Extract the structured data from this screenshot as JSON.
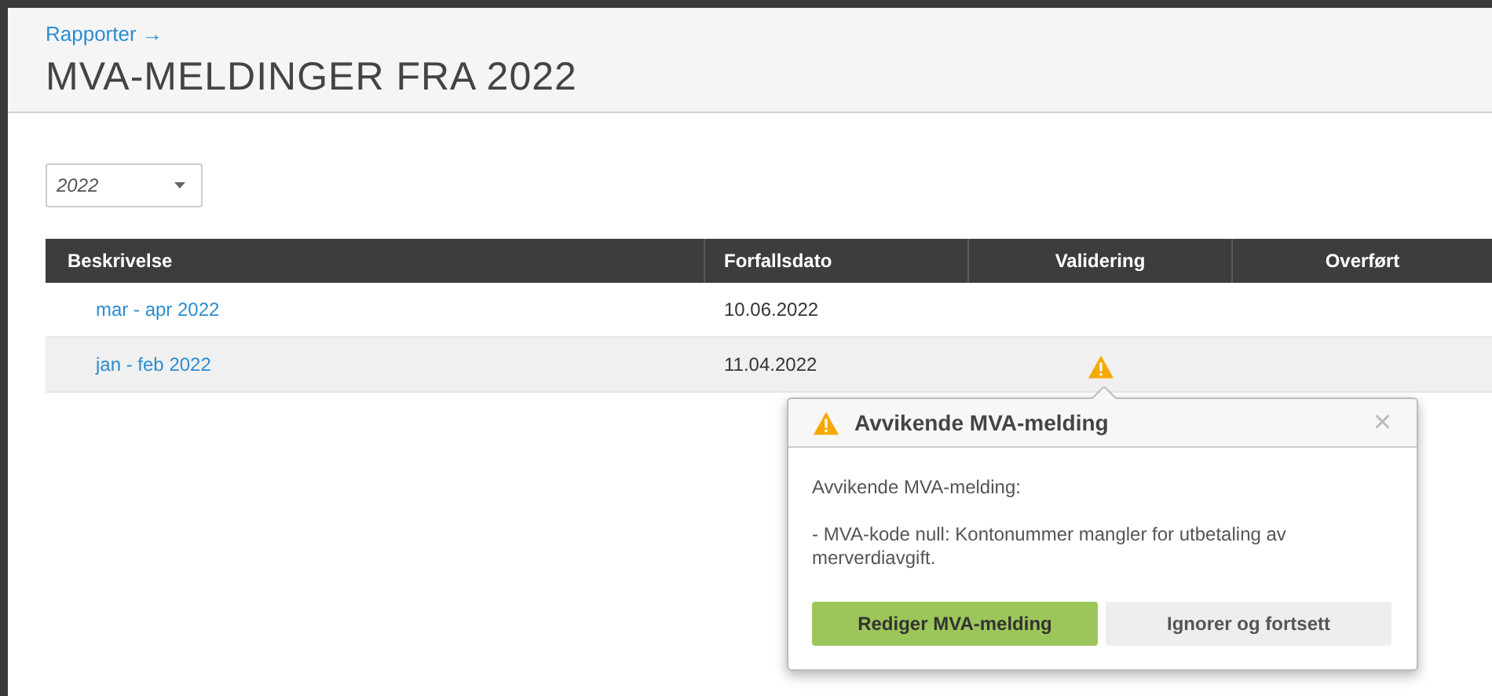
{
  "breadcrumb": "Rapporter →",
  "title": "MVA-MELDINGER FRA 2022",
  "year_select": {
    "value": "2022"
  },
  "table": {
    "columns": [
      "Beskrivelse",
      "Forfallsdato",
      "Validering",
      "Overført"
    ],
    "rows": [
      {
        "description": "mar - apr 2022",
        "due_date": "10.06.2022",
        "warning": false,
        "selected": false
      },
      {
        "description": "jan - feb 2022",
        "due_date": "11.04.2022",
        "warning": true,
        "selected": true
      }
    ]
  },
  "popover": {
    "title": "Avvikende MVA-melding",
    "close": "×",
    "heading": "Avvikende MVA-melding:",
    "message": "- MVA-kode null: Kontonummer mangler for utbetaling av merverdiavgift.",
    "buttons": [
      {
        "label": "Rediger MVA-melding",
        "kind": "primary"
      },
      {
        "label": "Ignorer og fortsett",
        "kind": "secondary"
      }
    ]
  }
}
